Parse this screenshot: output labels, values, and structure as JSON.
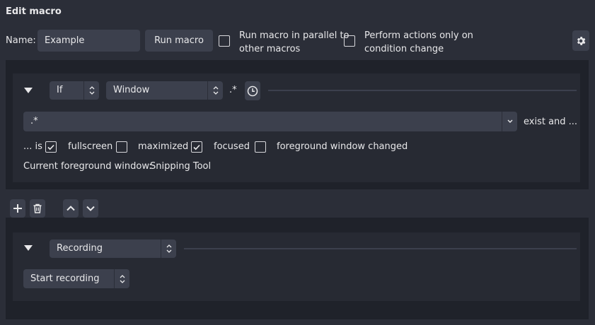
{
  "window": {
    "title": "Edit macro"
  },
  "header": {
    "name_label": "Name:",
    "name_value": "Example",
    "run_button": "Run macro",
    "parallel_line1": "Run macro in parallel to",
    "parallel_line2": "other macros",
    "parallel_checked": false,
    "onchange_line1": "Perform actions only on",
    "onchange_line2": "condition change",
    "onchange_checked": false,
    "settings_icon": "gear-icon"
  },
  "condition": {
    "logic_value": "If",
    "type_value": "Window",
    "regex_label": ".*",
    "clock_icon": "clock-icon",
    "window_value": ".*",
    "exist_label": "exist and ...",
    "is_label": "... is",
    "fullscreen_label": "fullscreen",
    "fullscreen_checked": true,
    "maximized_label": "maximized",
    "maximized_checked": false,
    "focused_label": "focused",
    "focused_checked": true,
    "fg_changed_label": "foreground window changed",
    "fg_changed_checked": false,
    "current_label": "Current foreground window:",
    "current_value": "Snipping Tool"
  },
  "toolbar": {
    "add_icon": "plus-icon",
    "delete_icon": "trash-icon",
    "up_icon": "chevron-up-icon",
    "down_icon": "chevron-down-icon"
  },
  "action": {
    "type_value": "Recording",
    "action_value": "Start recording"
  },
  "colors": {
    "background": "#2b2e38",
    "panel_outer": "#1f222a",
    "panel_inner": "#272a33",
    "control": "#3c404d",
    "text": "#e8e8ea"
  }
}
